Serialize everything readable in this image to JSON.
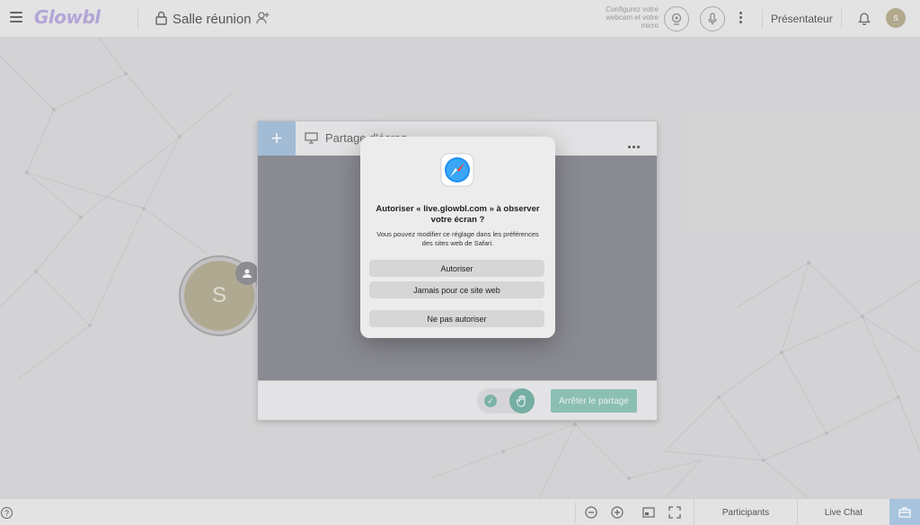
{
  "app": {
    "logo_text": "Glowbl"
  },
  "header": {
    "room_name": "Salle réunion",
    "config_hint": "Configurez votre webcam et votre micro",
    "presenter_label": "Présentateur",
    "user_initial": "S"
  },
  "stage": {
    "user_initial": "S"
  },
  "share_window": {
    "plus_label": "+",
    "title": "Partage d'écran",
    "stop_label": "Arrêter le partage",
    "check_glyph": "✓"
  },
  "dialog": {
    "title": "Autoriser « live.glowbl.com » à observer votre écran ?",
    "body": "Vous pouvez modifier ce réglage dans les préférences des sites web de Safari.",
    "allow_label": "Autoriser",
    "never_label": "Jamais pour ce site web",
    "deny_label": "Ne pas autoriser"
  },
  "footer": {
    "help_glyph": "?",
    "participants_label": "Participants",
    "live_chat_label": "Live Chat"
  },
  "colors": {
    "accent_blue": "#a7c3dd",
    "accent_green": "#76b4a6",
    "avatar": "#b6ae93",
    "logo": "#b3a6d6"
  }
}
